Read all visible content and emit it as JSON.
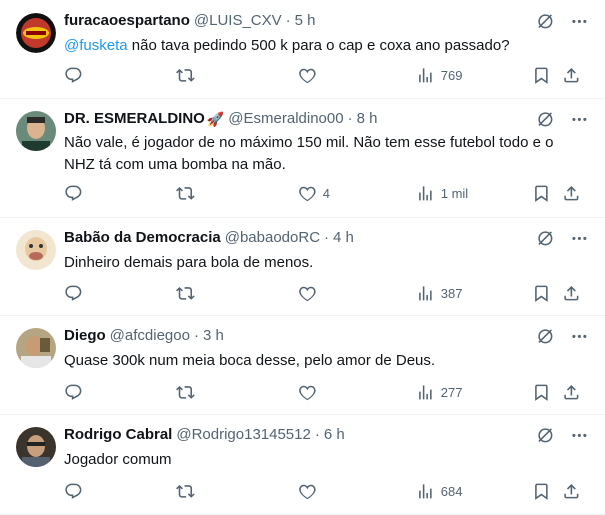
{
  "tweets": [
    {
      "name": "furacaoespartano",
      "handle": "@LUIS_CXV",
      "dot": "·",
      "time": "5 h",
      "mention": "@fusketa",
      "text": " não tava pedindo 500 k para o cap e coxa ano passado?",
      "views": "769",
      "likes": "",
      "avatar_color": "#c0392b"
    },
    {
      "name": "DR. ESMERALDINO",
      "emoji": "🚀",
      "handle": "@Esmeraldino00",
      "dot": "·",
      "time": "8 h",
      "text": "Não vale, é jogador de no máximo 150 mil. Não tem esse futebol todo e o NHZ tá com uma bomba na mão.",
      "views": "1 mil",
      "likes": "4",
      "avatar_color": "#3a5a4a"
    },
    {
      "name": "Babão da Democracia",
      "handle": "@babaodoRC",
      "dot": "·",
      "time": "4 h",
      "text": "Dinheiro demais para bola de menos.",
      "views": "387",
      "likes": "",
      "avatar_color": "#e8c8a0"
    },
    {
      "name": "Diego",
      "handle": "@afcdiegoo",
      "dot": "·",
      "time": "3 h",
      "text": "Quase 300k num meia boca desse, pelo amor de Deus.",
      "views": "277",
      "likes": "",
      "avatar_color": "#8a7a5a"
    },
    {
      "name": "Rodrigo Cabral",
      "handle": "@Rodrigo13145512",
      "dot": "·",
      "time": "6 h",
      "text": "Jogador comum",
      "views": "684",
      "likes": "",
      "avatar_color": "#4a4038"
    }
  ],
  "colors": {
    "text": "#0f1419",
    "secondary": "#536471",
    "link": "#1d9bf0",
    "border": "#eff3f4"
  }
}
